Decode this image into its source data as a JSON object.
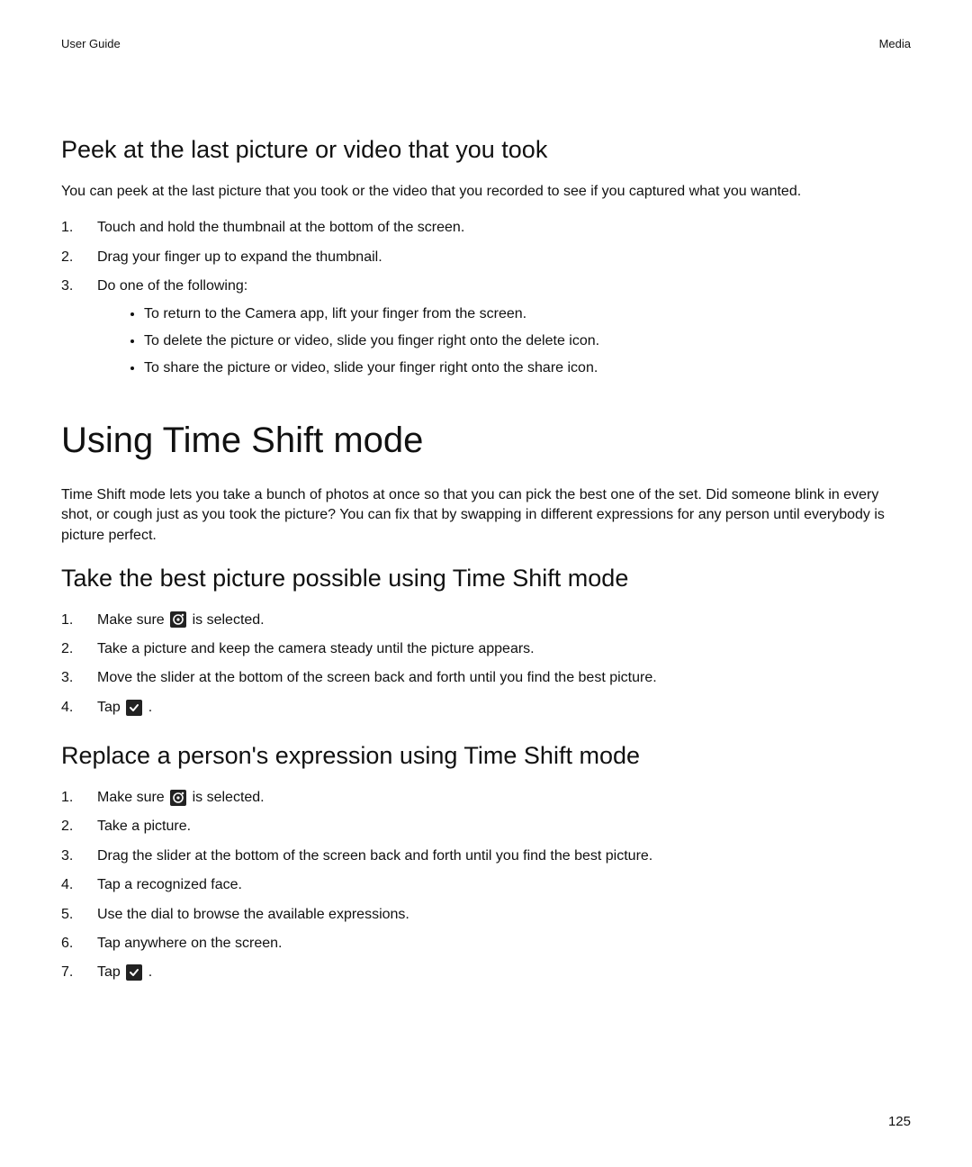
{
  "header": {
    "left": "User Guide",
    "right": "Media"
  },
  "sec1": {
    "title": "Peek at the last picture or video that you took",
    "intro": "You can peek at the last picture that you took or the video that you recorded to see if you captured what you wanted.",
    "step1": "Touch and hold the thumbnail at the bottom of the screen.",
    "step2": "Drag your finger up to expand the thumbnail.",
    "step3": "Do one of the following:",
    "sub1": "To return to the Camera app, lift your finger from the screen.",
    "sub2": "To delete the picture or video, slide you finger right onto the delete icon.",
    "sub3": "To share the picture or video, slide your finger right onto the share icon."
  },
  "main": {
    "title": "Using Time Shift mode",
    "intro": "Time Shift mode lets you take a bunch of photos at once so that you can pick the best one of the set. Did someone blink in every shot, or cough just as you took the picture? You can fix that by swapping in different expressions for any person until everybody is picture perfect."
  },
  "sec2": {
    "title": "Take the best picture possible using Time Shift mode",
    "step1a": "Make sure ",
    "step1b": " is selected.",
    "step2": "Take a picture and keep the camera steady until the picture appears.",
    "step3": "Move the slider at the bottom of the screen back and forth until you find the best picture.",
    "step4a": "Tap ",
    "step4b": " ."
  },
  "sec3": {
    "title": "Replace a person's expression using Time Shift mode",
    "step1a": "Make sure ",
    "step1b": " is selected.",
    "step2": "Take a picture.",
    "step3": "Drag the slider at the bottom of the screen back and forth until you find the best picture.",
    "step4": "Tap a recognized face.",
    "step5": "Use the dial to browse the available expressions.",
    "step6": "Tap anywhere on the screen.",
    "step7a": "Tap ",
    "step7b": " ."
  },
  "pageNumber": "125"
}
